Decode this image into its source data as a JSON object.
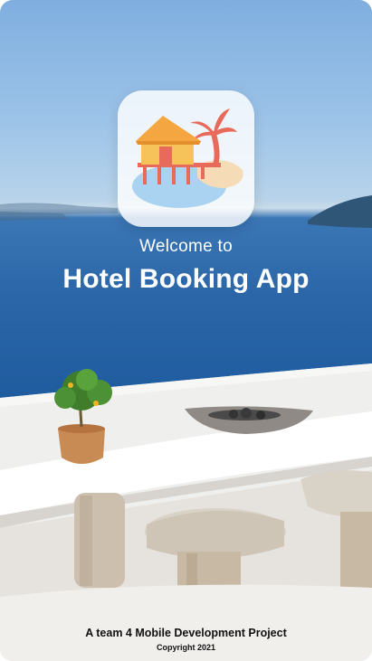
{
  "splash": {
    "welcome_text": "Welcome to",
    "app_title": "Hotel Booking App",
    "footer_text": "A team 4 Mobile Development Project",
    "copyright_text": "Copyright 2021"
  },
  "logo": {
    "icon": "beach-hut-icon",
    "colors": {
      "roof": "#f4a640",
      "hut": "#f6c25a",
      "posts": "#e86a5a",
      "palm_leaves": "#e86a5a",
      "sand": "#f6dcb6",
      "water": "#a9d3f0"
    }
  },
  "background": {
    "icon": "seaside-terrace-photo",
    "colors": {
      "sky": "#9cc3e8",
      "sea": "#2a66a8",
      "terrace": "#eeeeec"
    }
  }
}
